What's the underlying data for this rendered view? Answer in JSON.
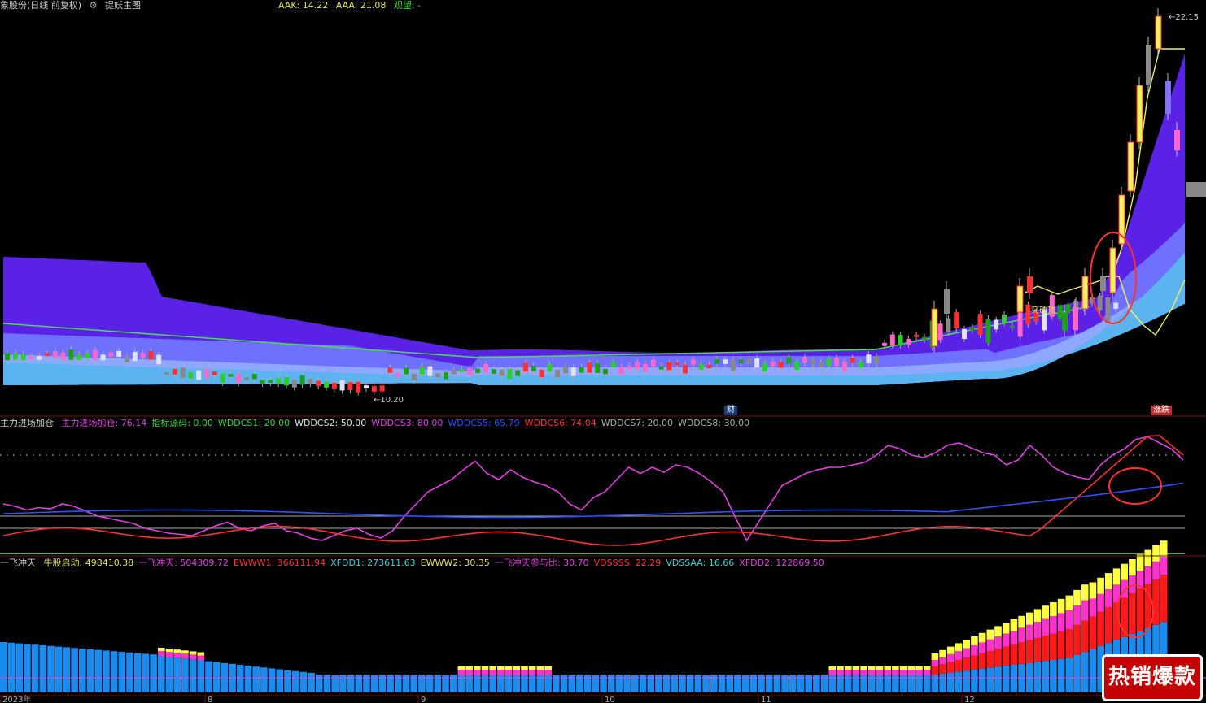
{
  "main_header": {
    "title": "象股份(日线 前复权)",
    "tool": "捉妖主图",
    "aak": "AAK: 14.22",
    "aaa": "AAA: 21.08",
    "watch": "观望: -",
    "colors": {
      "title": "#cccccc",
      "aak": "#e0e060",
      "aaa": "#e0e060",
      "watch": "#40d040"
    }
  },
  "ind1_header": {
    "name": "主力进场加仓",
    "items": [
      {
        "label": "主力进场加仓: 76.14",
        "color": "#e040e0"
      },
      {
        "label": "指标源码: 0.00",
        "color": "#40d040"
      },
      {
        "label": "WDDCS1: 20.00",
        "color": "#40d040"
      },
      {
        "label": "WDDCS2: 50.00",
        "color": "#e0e0e0"
      },
      {
        "label": "WDDCS3: 80.00",
        "color": "#e040e0"
      },
      {
        "label": "WDDCS5: 65.79",
        "color": "#3050ff"
      },
      {
        "label": "WDDCS6: 74.04",
        "color": "#ff3030"
      },
      {
        "label": "WDDCS7: 20.00",
        "color": "#aaaaaa"
      },
      {
        "label": "WDDCS8: 30.00",
        "color": "#aaaaaa"
      }
    ]
  },
  "ind2_header": {
    "name": "一飞冲天",
    "items": [
      {
        "label": "牛股启动: 498410.38",
        "color": "#e0e060"
      },
      {
        "label": "一飞冲天: 504309.72",
        "color": "#e040e0"
      },
      {
        "label": "EWWW1: 366111.94",
        "color": "#ff3030"
      },
      {
        "label": "XFDD1: 273611.63",
        "color": "#40d0d0"
      },
      {
        "label": "EWWW2: 30.35",
        "color": "#e0e060"
      },
      {
        "label": "一飞冲天参与比: 30.70",
        "color": "#e040e0"
      },
      {
        "label": "VDSSSS: 22.29",
        "color": "#ff3030"
      },
      {
        "label": "VDSSAA: 16.66",
        "color": "#40d0d0"
      },
      {
        "label": "XFDD2: 122869.50",
        "color": "#e040e0"
      }
    ]
  },
  "annotations": {
    "high": "22.15",
    "low": "10.20",
    "breakout": "突破顶",
    "finance": "财",
    "limit": "涨跌"
  },
  "x_axis": [
    "2023年",
    "8",
    "9",
    "10",
    "11",
    "12"
  ],
  "badge": "热销爆款",
  "chart_data": {
    "type": "candlestick",
    "price_range": [
      10.2,
      22.15
    ],
    "ind1_range": [
      0,
      100
    ],
    "ind1_levels": [
      20,
      30,
      50,
      80
    ]
  }
}
